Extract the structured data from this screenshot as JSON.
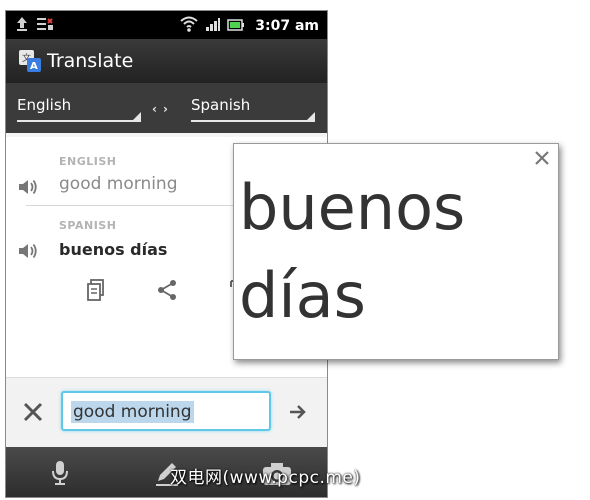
{
  "status_bar": {
    "time": "3:07 am"
  },
  "app": {
    "title": "Translate"
  },
  "languages": {
    "source": "English",
    "target": "Spanish",
    "swap_icon": "swap-icon"
  },
  "translation": {
    "source_caption": "ENGLISH",
    "source_text": "good morning",
    "target_caption": "SPANISH",
    "target_text": "buenos días"
  },
  "input": {
    "value": "good morning"
  },
  "popup": {
    "text": "buenos días"
  },
  "watermark": "双电网(www.pcpc.me)",
  "colors": {
    "accent_input_border": "#5fc7e8",
    "selection": "#bcd7ec",
    "statusbar": "#000000"
  }
}
